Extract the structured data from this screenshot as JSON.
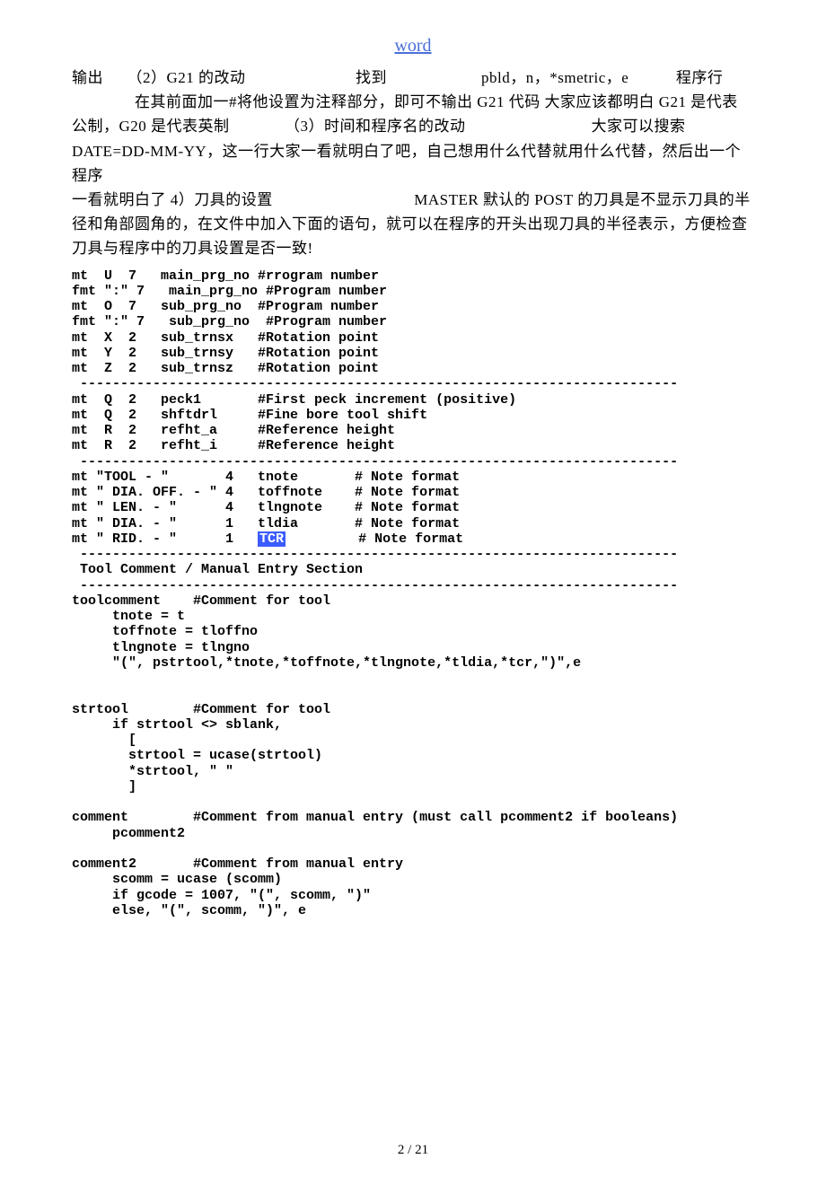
{
  "header": {
    "link_text": "word"
  },
  "chinese": {
    "p1": "输出　　（2）G21 的改动　　　　　　　找到　　　　　　pbld，n，*smetric，e　　　程序行",
    "p2": "　　　　在其前面加一#将他设置为注释部分，即可不输出 G21 代码 大家应该都明白 G21 是代表",
    "p3": "公制，G20 是代表英制　　　　（3）时间和程序名的改动　　　　　　　　大家可以搜索",
    "p4": "DATE=DD-MM-YY，这一行大家一看就明白了吧，自己想用什么代替就用什么代替，然后出一个程序",
    "p5": "一看就明白了 4）刀具的设置　　　　　　　　　MASTER 默认的 POST 的刀具是不显示刀具的半",
    "p6": "径和角部圆角的，在文件中加入下面的语句，就可以在程序的开头出现刀具的半径表示，方便检查",
    "p7": "刀具与程序中的刀具设置是否一致!"
  },
  "code": {
    "l1": "mt  U  7   main_prg_no #rrogram number",
    "l2": "fmt \":\" 7   main_prg_no #Program number",
    "l3": "mt  O  7   sub_prg_no  #Program number",
    "l4": "fmt \":\" 7   sub_prg_no  #Program number",
    "l5": "mt  X  2   sub_trnsx   #Rotation point",
    "l6": "mt  Y  2   sub_trnsy   #Rotation point",
    "l7": "mt  Z  2   sub_trnsz   #Rotation point",
    "sep1": " --------------------------------------------------------------------------",
    "l8": "mt  Q  2   peck1       #First peck increment (positive)",
    "l9": "mt  Q  2   shftdrl     #Fine bore tool shift",
    "l10": "mt  R  2   refht_a     #Reference height",
    "l11": "mt  R  2   refht_i     #Reference height",
    "sep2": " --------------------------------------------------------------------------",
    "l12": "mt \"TOOL - \"       4   tnote       # Note format",
    "l13": "mt \" DIA. OFF. - \" 4   toffnote    # Note format",
    "l14": "mt \" LEN. - \"      4   tlngnote    # Note format",
    "l15": "mt \" DIA. - \"      1   tldia       # Note format",
    "l16a": "mt \" RID. - \"      1   ",
    "l16hl": "TCR",
    "l16b": "         # Note format",
    "sep3": " --------------------------------------------------------------------------",
    "l17": " Tool Comment / Manual Entry Section",
    "sep4": " --------------------------------------------------------------------------",
    "l18": "toolcomment    #Comment for tool",
    "l19": "     tnote = t",
    "l20": "     toffnote = tloffno",
    "l21": "     tlngnote = tlngno",
    "l22": "     \"(\", pstrtool,*tnote,*toffnote,*tlngnote,*tldia,*tcr,\")\",e",
    "l23": "",
    "l24": "",
    "l25": "strtool        #Comment for tool",
    "l26": "     if strtool <> sblank,",
    "l27": "       [",
    "l28": "       strtool = ucase(strtool)",
    "l29": "       *strtool, \" \"",
    "l30": "       ]",
    "l31": "",
    "l32": "comment        #Comment from manual entry (must call pcomment2 if booleans)",
    "l33": "     pcomment2",
    "l34": "",
    "l35": "comment2       #Comment from manual entry",
    "l36": "     scomm = ucase (scomm)",
    "l37": "     if gcode = 1007, \"(\", scomm, \")\"",
    "l38": "     else, \"(\", scomm, \")\", e"
  },
  "footer": {
    "page": "2 / 21"
  }
}
